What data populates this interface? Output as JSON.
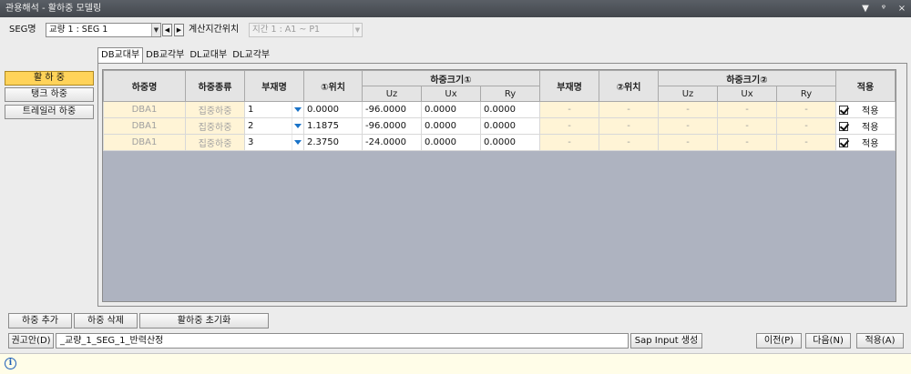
{
  "window": {
    "title": "관용해석 - 활하중 모델링",
    "controls": [
      "▼",
      "ᵠ",
      "×"
    ]
  },
  "seg": {
    "label": "SEG명",
    "value": "교량 1 : SEG 1",
    "span_label": "계산지간위치",
    "span_value": "지간 1 : A1 ~ P1"
  },
  "side_buttons": [
    "활 하 중",
    "탱크 하중",
    "트레일러 하중"
  ],
  "tabs": [
    "DB교대부",
    "DB교각부",
    "DL교대부",
    "DL교각부"
  ],
  "grid": {
    "headers": {
      "load_name": "하중명",
      "load_type": "하중종류",
      "member": "부재명",
      "pos1": "①위치",
      "mag1": "하중크기①",
      "member2": "부재명",
      "pos2": "②위치",
      "mag2": "하중크기②",
      "apply": "적용",
      "uz": "Uz",
      "ux": "Ux",
      "ry": "Ry"
    },
    "rows": [
      {
        "name": "DBA1",
        "type": "집중하중",
        "member": "1",
        "pos": "0.0000",
        "uz": "-96.0000",
        "ux": "0.0000",
        "ry": "0.0000",
        "d": "-",
        "apply_label": "적용",
        "checked": true
      },
      {
        "name": "DBA1",
        "type": "집중하중",
        "member": "2",
        "pos": "1.1875",
        "uz": "-96.0000",
        "ux": "0.0000",
        "ry": "0.0000",
        "d": "-",
        "apply_label": "적용",
        "checked": true
      },
      {
        "name": "DBA1",
        "type": "집중하중",
        "member": "3",
        "pos": "2.3750",
        "uz": "-24.0000",
        "ux": "0.0000",
        "ry": "0.0000",
        "d": "-",
        "apply_label": "적용",
        "checked": true
      }
    ]
  },
  "bottom": {
    "add": "하중 추가",
    "delete": "하중 삭제",
    "reset": "활하중 초기화",
    "manual": "권고안(D)",
    "filename": "_교량_1_SEG_1_반력산정",
    "sap": "Sap Input 생성",
    "prev": "이전(P)",
    "next": "다음(N)",
    "apply": "적용(A)"
  },
  "status": {
    "icon": "info-icon"
  }
}
